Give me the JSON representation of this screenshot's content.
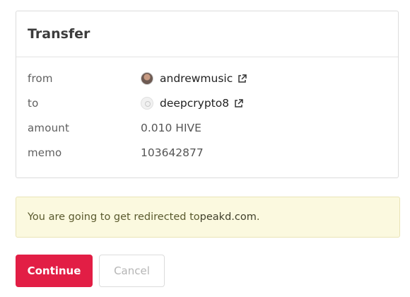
{
  "card": {
    "title": "Transfer"
  },
  "fields": {
    "from": {
      "label": "from",
      "value": "andrewmusic"
    },
    "to": {
      "label": "to",
      "value": "deepcrypto8"
    },
    "amount": {
      "label": "amount",
      "value": "0.010 HIVE"
    },
    "memo": {
      "label": "memo",
      "value": "103642877"
    }
  },
  "notice": {
    "prefix": "You are going to get redirected to ",
    "domain": "peakd.com",
    "suffix": "."
  },
  "buttons": {
    "continue": "Continue",
    "cancel": "Cancel"
  },
  "colors": {
    "accent": "#e21e45",
    "notice_bg": "#fbf9df"
  },
  "icons": {
    "external": "external-link-icon"
  }
}
